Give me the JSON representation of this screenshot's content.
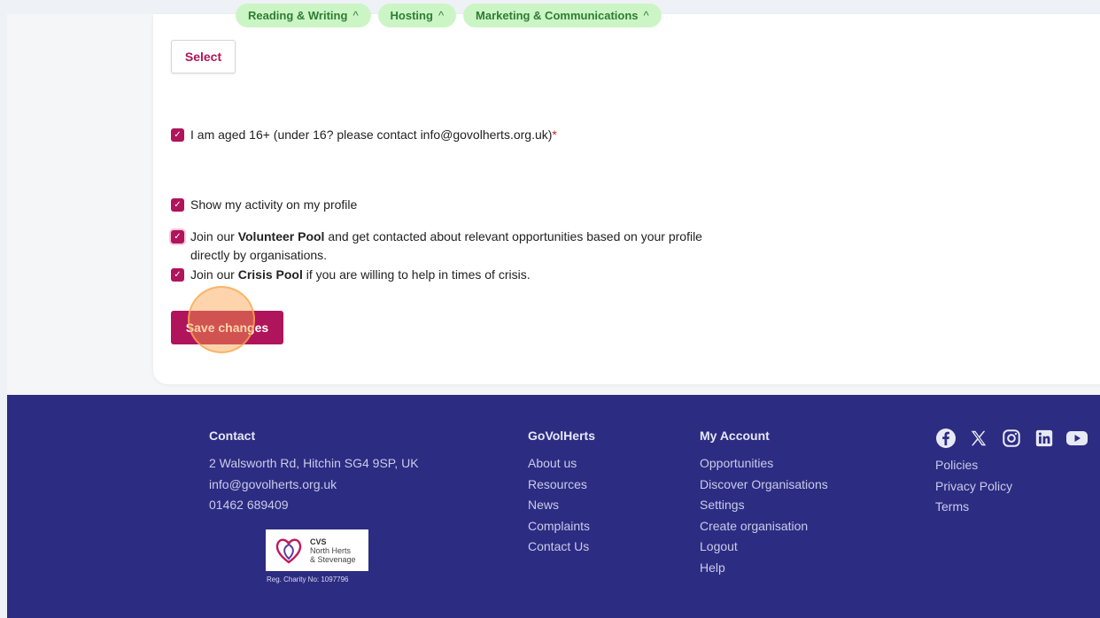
{
  "tags": [
    {
      "label": "Reading & Writing"
    },
    {
      "label": "Hosting"
    },
    {
      "label": "Marketing & Communications"
    }
  ],
  "tag_remove_glyph": "^",
  "select_label": "Select",
  "age_check": {
    "label": "I am aged 16+ (under 16? please contact info@govolherts.org.uk)",
    "required_mark": "*"
  },
  "activity_check": {
    "label": "Show my activity on my profile"
  },
  "volunteer_pool": {
    "prefix": "Join our ",
    "bold": "Volunteer Pool",
    "suffix": " and get contacted about relevant opportunities based on your profile",
    "line2": "directly by organisations."
  },
  "crisis_pool": {
    "prefix": "Join our ",
    "bold": "Crisis Pool",
    "suffix": " if you are willing to help in times of crisis."
  },
  "save_label": "Save changes",
  "footer": {
    "contact": {
      "heading": "Contact",
      "items": [
        "2 Walsworth Rd, Hitchin SG4 9SP, UK",
        "info@govolherts.org.uk",
        "01462 689409"
      ]
    },
    "govolherts": {
      "heading": "GoVolHerts",
      "items": [
        "About us",
        "Resources",
        "News",
        "Complaints",
        "Contact Us"
      ]
    },
    "account": {
      "heading": "My Account",
      "items": [
        "Opportunities",
        "Discover Organisations",
        "Settings",
        "Create organisation",
        "Logout",
        "Help"
      ]
    },
    "policies": {
      "items": [
        "Policies",
        "Privacy Policy",
        "Terms"
      ]
    },
    "logo": {
      "line1": "CVS",
      "line2": "North Herts",
      "line3": "& Stevenage",
      "charity": "Reg. Charity No: 1097796"
    },
    "social_icons": [
      "facebook-icon",
      "x-icon",
      "instagram-icon",
      "linkedin-icon",
      "youtube-icon"
    ]
  },
  "colors": {
    "primary": "#b0145a",
    "footer_bg": "#2c2c82",
    "tag_bg": "#ccf5c6",
    "tag_text": "#2e7d32"
  }
}
